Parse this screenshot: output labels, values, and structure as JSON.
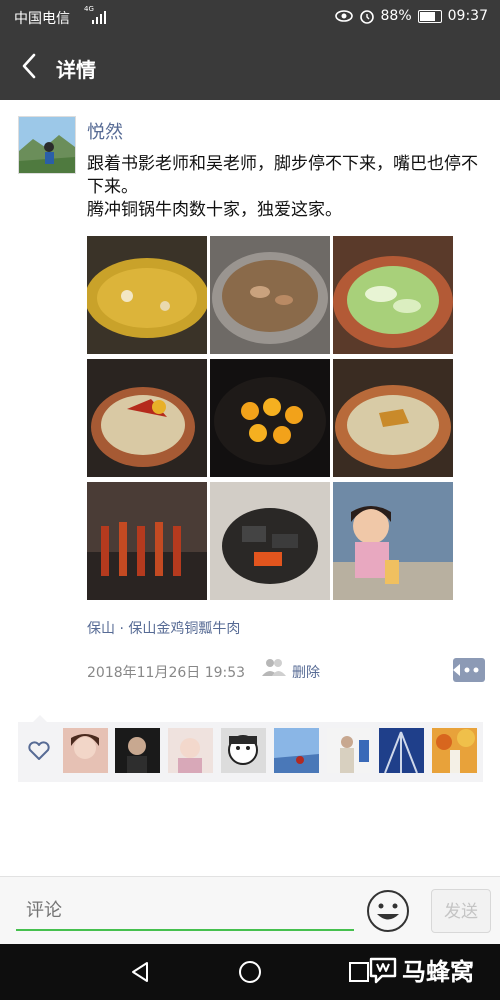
{
  "status_bar": {
    "carrier": "中国电信",
    "network": "4G",
    "battery": "88%",
    "battery_level": 0.88,
    "time": "09:37",
    "icons": [
      "signal-icon",
      "eye-icon",
      "alarm-icon",
      "battery-icon"
    ]
  },
  "app_bar": {
    "title": "详情",
    "back_icon": "chevron-left-icon"
  },
  "post": {
    "username": "悦然",
    "text_line1": "跟着书影老师和吴老师，脚步停不下来，嘴巴也停不下来。",
    "text_line2": "腾冲铜锅牛肉数十家，独爱这家。",
    "photos": [
      "soup-pot",
      "beef-pan",
      "cabbage-pot",
      "chili-hotpot",
      "egg-yolk-pan",
      "copper-hotpot",
      "skewers",
      "charcoal-grill",
      "girl-with-drink"
    ],
    "location": "保山 · 保山金鸡铜瓢牛肉",
    "timestamp": "2018年11月26日 19:53",
    "delete_label": "删除"
  },
  "likes": {
    "count": 8,
    "icon": "heart-icon"
  },
  "comment_bar": {
    "placeholder": "评论",
    "send_label": "发送",
    "emoji_icon": "emoji-icon"
  },
  "nav_bar": {
    "icons": [
      "back-triangle-icon",
      "home-circle-icon",
      "recent-square-icon"
    ]
  },
  "watermark": {
    "text": "马蜂窝"
  },
  "colors": {
    "link": "#576b95",
    "header_bg": "#3a3a3a",
    "accent_green": "#46c04e"
  }
}
